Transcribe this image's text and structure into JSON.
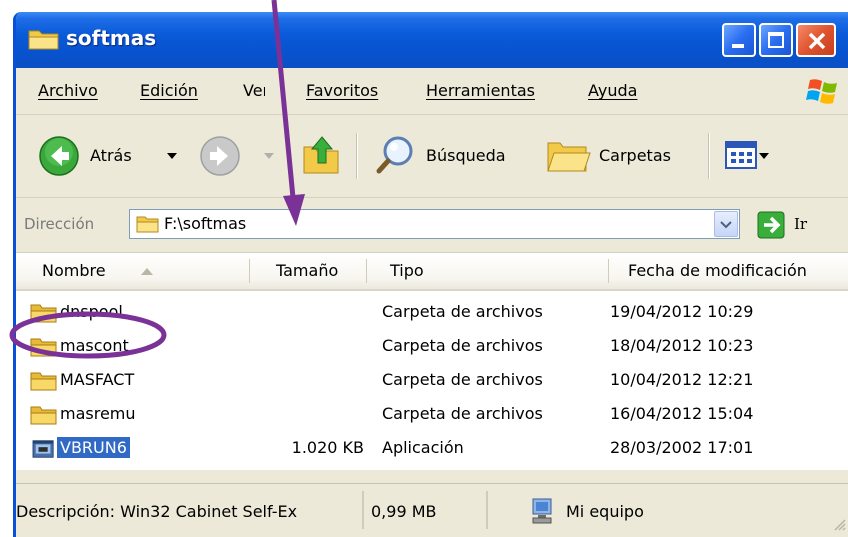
{
  "window": {
    "title": "softmas",
    "title_icon": "folder-icon",
    "accent": "#0a5ad9",
    "close_color": "#e0542f"
  },
  "menu": {
    "items": [
      "Archivo",
      "Edición",
      "Ver",
      "Favoritos",
      "Herramientas",
      "Ayuda"
    ]
  },
  "toolbar": {
    "back_label": "Atrás",
    "search_label": "Búsqueda",
    "folders_label": "Carpetas"
  },
  "address": {
    "label": "Dirección",
    "value": "F:\\softmas",
    "go_label": "Ir"
  },
  "columns": [
    "Nombre",
    "Tamaño",
    "Tipo",
    "Fecha de modificación"
  ],
  "files": [
    {
      "name": "dnspool",
      "size": "",
      "type": "Carpeta de archivos",
      "date": "19/04/2012 10:29",
      "icon": "folder-icon"
    },
    {
      "name": "mascont",
      "size": "",
      "type": "Carpeta de archivos",
      "date": "18/04/2012 10:23",
      "icon": "folder-icon"
    },
    {
      "name": "MASFACT",
      "size": "",
      "type": "Carpeta de archivos",
      "date": "10/04/2012 12:21",
      "icon": "folder-icon"
    },
    {
      "name": "masremu",
      "size": "",
      "type": "Carpeta de archivos",
      "date": "16/04/2012 15:04",
      "icon": "folder-icon"
    },
    {
      "name": "VBRUN6",
      "size": "1.020 KB",
      "type": "Aplicación",
      "date": "28/03/2002 17:01",
      "icon": "application-icon",
      "selected": true
    }
  ],
  "status": {
    "description": "Descripción: Win32 Cabinet Self-Ex",
    "size": "0,99 MB",
    "location": "Mi equipo"
  },
  "annotation": {
    "color": "#7b3296"
  }
}
